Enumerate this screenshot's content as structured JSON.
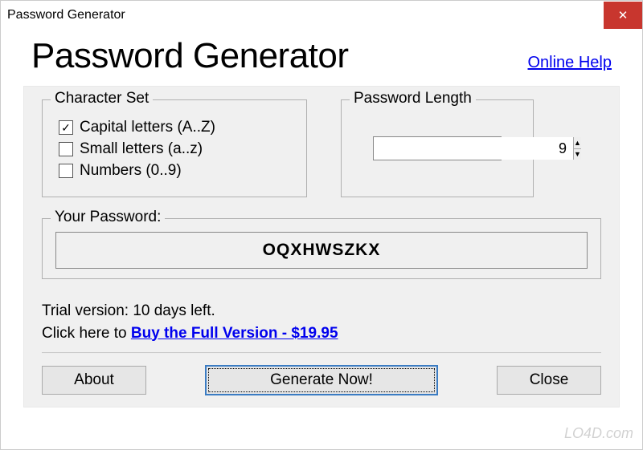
{
  "window": {
    "title": "Password Generator"
  },
  "header": {
    "app_title": "Password Generator",
    "help_link": "Online Help"
  },
  "charset": {
    "legend": "Character Set",
    "options": [
      {
        "label": "Capital letters (A..Z)",
        "checked": true
      },
      {
        "label": "Small letters (a..z)",
        "checked": false
      },
      {
        "label": "Numbers (0..9)",
        "checked": false
      }
    ]
  },
  "length": {
    "legend": "Password Length",
    "value": "9"
  },
  "output": {
    "legend": "Your Password:",
    "value": "OQXHWSZKX"
  },
  "trial": {
    "line1": "Trial version: 10 days left.",
    "line2_prefix": "Click here to ",
    "buy_link": "Buy the Full Version - $19.95"
  },
  "buttons": {
    "about": "About",
    "generate": "Generate Now!",
    "close": "Close"
  },
  "watermark": "LO4D.com"
}
